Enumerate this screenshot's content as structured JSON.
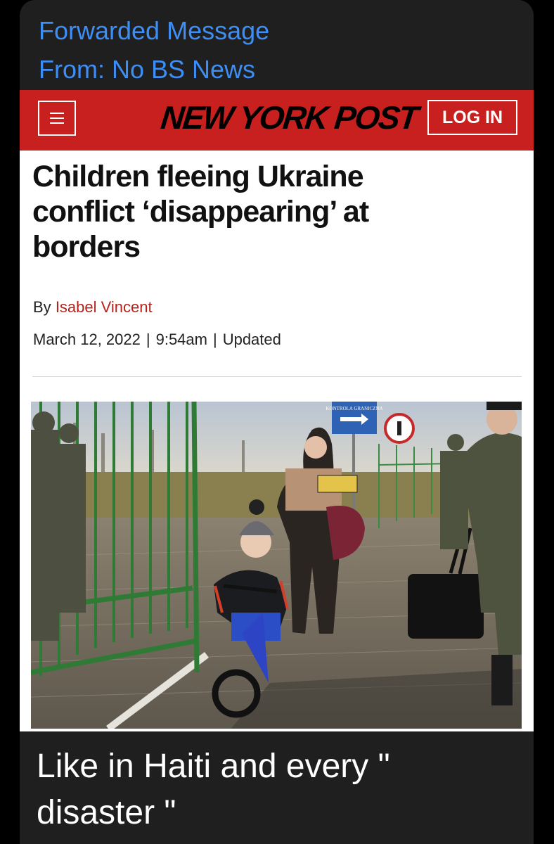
{
  "forward": {
    "title": "Forwarded Message",
    "from": "From: No BS News"
  },
  "article": {
    "logo": "NEW YORK POST",
    "login_label": "LOG IN",
    "headline": "Children fleeing Ukraine conflict ‘disappearing’ at borders",
    "byline_prefix": "By",
    "author": "Isabel Vincent",
    "date": "March 12, 2022",
    "time": "9:54am",
    "updated": "Updated",
    "separator": "|",
    "photo_sign": "KONTROLA GRANICZNA"
  },
  "message": {
    "text": "Like in Haiti and every \" disaster \""
  },
  "colors": {
    "brand_red": "#c8201f",
    "link_blue": "#3d8ef5",
    "author_red": "#b8221c",
    "bubble_bg": "#1f1f1f"
  }
}
